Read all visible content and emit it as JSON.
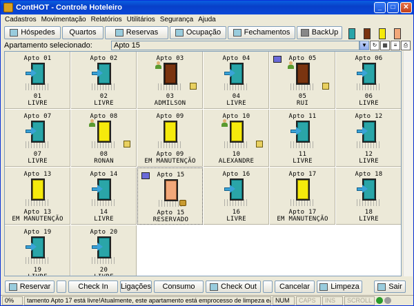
{
  "window": {
    "title": "ContHOT - Controle Hoteleiro"
  },
  "menu": [
    "Cadastros",
    "Movimentação",
    "Relatórios",
    "Utilitários",
    "Segurança",
    "Ajuda"
  ],
  "toolbar": {
    "buttons": [
      {
        "label": "Hóspedes",
        "icon": "guests-icon"
      },
      {
        "label": "Quartos",
        "icon": "rooms-icon"
      },
      {
        "label": "Reservas",
        "icon": "reservations-icon"
      },
      {
        "label": "Ocupação",
        "icon": "occupancy-icon"
      },
      {
        "label": "Fechamentos",
        "icon": "closing-icon"
      },
      {
        "label": "BackUp",
        "icon": "backup-icon"
      }
    ]
  },
  "selection": {
    "label": "Apartamento selecionado:",
    "value": "Apto 15"
  },
  "rooms": [
    {
      "name": "Apto 01",
      "num": "01",
      "status": "LIVRE",
      "state": "free"
    },
    {
      "name": "Apto 02",
      "num": "02",
      "status": "LIVRE",
      "state": "free"
    },
    {
      "name": "Apto 03",
      "num": "03",
      "status": "ADMILSON",
      "state": "occupied"
    },
    {
      "name": "Apto 04",
      "num": "04",
      "status": "LIVRE",
      "state": "free"
    },
    {
      "name": "Apto 05",
      "num": "05",
      "status": "RUI",
      "state": "occupied"
    },
    {
      "name": "Apto 06",
      "num": "06",
      "status": "LIVRE",
      "state": "free"
    },
    {
      "name": "Apto 07",
      "num": "07",
      "status": "LIVRE",
      "state": "free"
    },
    {
      "name": "Apto 08",
      "num": "08",
      "status": "RONAN",
      "state": "occupied-maint"
    },
    {
      "name": "Apto 09",
      "num": "09",
      "status": "EM MANUTENÇÃO",
      "state": "maint"
    },
    {
      "name": "Apto 10",
      "num": "10",
      "status": "ALEXANDRE",
      "state": "occupied-maint"
    },
    {
      "name": "Apto 11",
      "num": "11",
      "status": "LIVRE",
      "state": "free"
    },
    {
      "name": "Apto 12",
      "num": "12",
      "status": "LIVRE",
      "state": "free"
    },
    {
      "name": "Apto 13",
      "num": "13",
      "status": "EM MANUTENÇÃO",
      "state": "maint"
    },
    {
      "name": "Apto 14",
      "num": "14",
      "status": "LIVRE",
      "state": "free"
    },
    {
      "name": "Apto 15",
      "num": "15",
      "status": "RESERVADO",
      "state": "reserved"
    },
    {
      "name": "Apto 16",
      "num": "16",
      "status": "LIVRE",
      "state": "free"
    },
    {
      "name": "Apto 17",
      "num": "17",
      "status": "EM MANUTENÇÃO",
      "state": "maint"
    },
    {
      "name": "Apto 18",
      "num": "18",
      "status": "LIVRE",
      "state": "free"
    },
    {
      "name": "Apto 19",
      "num": "19",
      "status": "LIVRE",
      "state": "free"
    },
    {
      "name": "Apto 20",
      "num": "20",
      "status": "LIVRE",
      "state": "free"
    }
  ],
  "bottom": {
    "buttons": [
      "Reservar",
      "Check In",
      "Ligações",
      "Consumo",
      "Check Out",
      "Cancelar",
      "Limpeza",
      "Sair"
    ]
  },
  "status": {
    "progress": "0%",
    "message": "tamento Apto 17 está livre!Atualmente, este apartamento está emprocesso de limpeza e/ou arrur",
    "num": "NUM",
    "caps": "CAPS",
    "ins": "INS",
    "scroll": "SCROLL"
  },
  "colors": {
    "door_free": "#2aa5a8",
    "door_occupied": "#7a3410",
    "door_maint": "#f5ea0c",
    "door_reserved": "#f2a87a"
  }
}
